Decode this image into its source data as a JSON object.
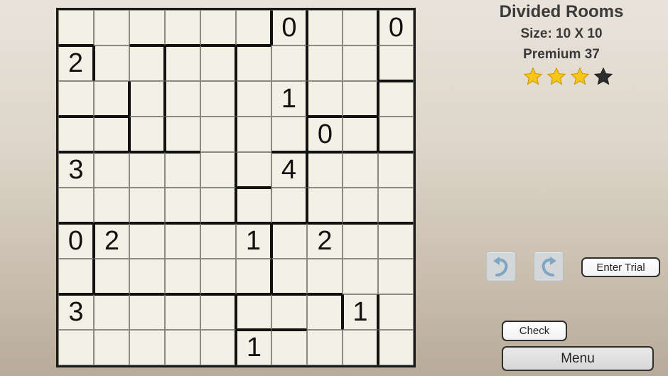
{
  "puzzle": {
    "title": "Divided Rooms",
    "size_label": "Size: 10 X 10",
    "level_label": "Premium 37",
    "rating": 3,
    "max_rating": 4,
    "star_colors": {
      "filled": "#f5c518",
      "empty": "#2d2d2d"
    }
  },
  "board": {
    "rows": 10,
    "cols": 10,
    "clues": [
      [
        "",
        "",
        "",
        "",
        "",
        "",
        "0",
        "",
        "",
        "0"
      ],
      [
        "2",
        "",
        "",
        "",
        "",
        "",
        "",
        "",
        "",
        ""
      ],
      [
        "",
        "",
        "",
        "",
        "",
        "",
        "1",
        "",
        "",
        ""
      ],
      [
        "",
        "",
        "",
        "",
        "",
        "",
        "",
        "0",
        "",
        ""
      ],
      [
        "3",
        "",
        "",
        "",
        "",
        "",
        "4",
        "",
        "",
        ""
      ],
      [
        "",
        "",
        "",
        "",
        "",
        "",
        "",
        "",
        "",
        ""
      ],
      [
        "0",
        "2",
        "",
        "",
        "",
        "1",
        "",
        "2",
        "",
        ""
      ],
      [
        "",
        "",
        "",
        "",
        "",
        "",
        "",
        "",
        "",
        ""
      ],
      [
        "3",
        "",
        "",
        "",
        "",
        "",
        "",
        "",
        "1",
        ""
      ],
      [
        "",
        "",
        "",
        "",
        "",
        "1",
        "",
        "",
        "",
        ""
      ]
    ],
    "walls_right": [
      [
        0,
        0,
        0,
        0,
        0,
        1,
        1,
        0,
        1,
        0
      ],
      [
        1,
        0,
        1,
        0,
        1,
        0,
        1,
        0,
        1,
        0
      ],
      [
        0,
        1,
        1,
        0,
        1,
        0,
        1,
        0,
        1,
        0
      ],
      [
        0,
        1,
        1,
        0,
        1,
        0,
        1,
        0,
        1,
        0
      ],
      [
        0,
        0,
        0,
        0,
        1,
        0,
        1,
        0,
        0,
        0
      ],
      [
        0,
        0,
        0,
        0,
        1,
        0,
        1,
        0,
        0,
        0
      ],
      [
        1,
        0,
        0,
        0,
        0,
        1,
        0,
        0,
        0,
        0
      ],
      [
        1,
        0,
        0,
        0,
        0,
        1,
        0,
        0,
        0,
        0
      ],
      [
        0,
        0,
        0,
        0,
        1,
        0,
        0,
        1,
        1,
        0
      ],
      [
        0,
        0,
        0,
        0,
        1,
        0,
        0,
        0,
        1,
        0
      ]
    ],
    "walls_bottom": [
      [
        1,
        0,
        1,
        1,
        1,
        1,
        0,
        0,
        0,
        0
      ],
      [
        0,
        0,
        0,
        0,
        0,
        0,
        0,
        0,
        0,
        1
      ],
      [
        1,
        1,
        0,
        0,
        0,
        0,
        0,
        1,
        1,
        0
      ],
      [
        1,
        1,
        1,
        1,
        0,
        0,
        1,
        1,
        1,
        1
      ],
      [
        0,
        0,
        0,
        0,
        0,
        1,
        0,
        0,
        0,
        0
      ],
      [
        1,
        1,
        1,
        1,
        1,
        1,
        1,
        1,
        1,
        1
      ],
      [
        0,
        0,
        0,
        0,
        0,
        0,
        0,
        0,
        0,
        0
      ],
      [
        1,
        1,
        1,
        1,
        1,
        1,
        1,
        1,
        0,
        0
      ],
      [
        0,
        0,
        0,
        0,
        0,
        1,
        1,
        0,
        0,
        0
      ],
      [
        0,
        0,
        0,
        0,
        0,
        0,
        0,
        0,
        0,
        0
      ]
    ]
  },
  "controls": {
    "undo_icon": "undo-arrow-icon",
    "redo_icon": "redo-arrow-icon",
    "enter_trial_label": "Enter Trial",
    "check_label": "Check",
    "menu_label": "Menu"
  }
}
